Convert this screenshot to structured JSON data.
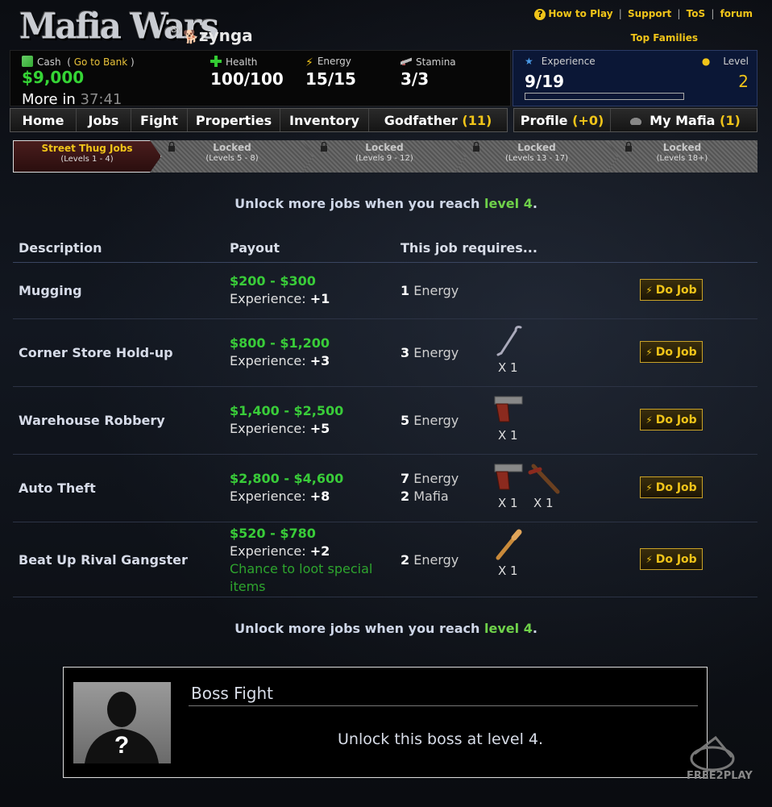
{
  "header": {
    "logo": "Mafia Wars",
    "by": "By",
    "brand": "zynga",
    "links": [
      "How to Play",
      "Support",
      "ToS",
      "forum"
    ],
    "top_families": "Top Families"
  },
  "stats": {
    "cash_label": "Cash",
    "go_to_bank": "Go to Bank",
    "cash_value": "$9,000",
    "more_in_label": "More in",
    "more_in_time": "37:41",
    "health_label": "Health",
    "health_value": "100/100",
    "energy_label": "Energy",
    "energy_value": "15/15",
    "stamina_label": "Stamina",
    "stamina_value": "3/3",
    "experience_label": "Experience",
    "experience_value": "9/19",
    "experience_progress": 0.0,
    "level_label": "Level",
    "level_value": "2"
  },
  "nav": {
    "items": [
      "Home",
      "Jobs",
      "Fight",
      "Properties",
      "Inventory"
    ],
    "godfather_label": "Godfather",
    "godfather_count": "(11)",
    "profile_label": "Profile",
    "profile_count": "(+0)",
    "mymafia_label": "My Mafia",
    "mymafia_count": "(1)"
  },
  "job_tabs": [
    {
      "title": "Street Thug Jobs",
      "levels": "(Levels 1 - 4)"
    },
    {
      "title": "Locked",
      "levels": "(Levels 5 - 8)"
    },
    {
      "title": "Locked",
      "levels": "(Levels 9 - 12)"
    },
    {
      "title": "Locked",
      "levels": "(Levels 13 - 17)"
    },
    {
      "title": "Locked",
      "levels": "(Levels 18+)"
    }
  ],
  "unlock": {
    "text": "Unlock more jobs when you reach",
    "level": "level 4",
    "period": "."
  },
  "table": {
    "headers": [
      "Description",
      "Payout",
      "This job requires..."
    ],
    "exp_label": "Experience:",
    "do_job": "Do Job",
    "rows": [
      {
        "name": "Mugging",
        "payout": "$200 - $300",
        "exp": "+1",
        "energy_n": "1",
        "energy": "Energy"
      },
      {
        "name": "Corner Store Hold-up",
        "payout": "$800 - $1,200",
        "exp": "+3",
        "energy_n": "3",
        "energy": "Energy",
        "items": [
          {
            "icon": "crowbar",
            "qty": "X 1"
          }
        ]
      },
      {
        "name": "Warehouse Robbery",
        "payout": "$1,400 - $2,500",
        "exp": "+5",
        "energy_n": "5",
        "energy": "Energy",
        "items": [
          {
            "icon": "pistol",
            "qty": "X 1"
          }
        ]
      },
      {
        "name": "Auto Theft",
        "payout": "$2,800 - $4,600",
        "exp": "+8",
        "energy_n": "7",
        "energy": "Energy",
        "mafia_n": "2",
        "mafia": "Mafia",
        "items": [
          {
            "icon": "pistol",
            "qty": "X 1"
          },
          {
            "icon": "shotgun",
            "qty": "X 1"
          }
        ]
      },
      {
        "name": "Beat Up Rival Gangster",
        "payout": "$520 - $780",
        "exp": "+2",
        "chance": "Chance to loot special items",
        "energy_n": "2",
        "energy": "Energy",
        "items": [
          {
            "icon": "baseball-bat",
            "qty": "X 1"
          }
        ]
      }
    ]
  },
  "boss": {
    "title": "Boss Fight",
    "message": "Unlock this boss at level 4.",
    "avatar_mark": "?"
  },
  "watermark": "FREE2PLAY"
}
